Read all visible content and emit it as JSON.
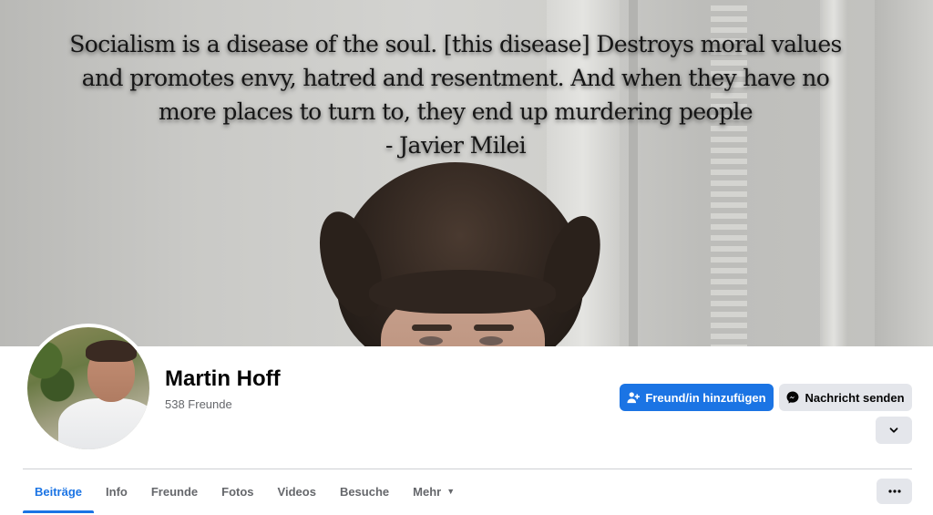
{
  "cover": {
    "quote_lines": [
      "Socialism is a disease of the soul. [this disease] Destroys moral values",
      "and promotes envy, hatred and resentment. And when they have no",
      "more places to turn to,  they end up murdering people",
      "- Javier Milei"
    ]
  },
  "profile": {
    "name": "Martin Hoff",
    "friends": "538 Freunde"
  },
  "actions": {
    "add_friend_label": "Freund/in hinzufügen",
    "message_label": "Nachricht senden"
  },
  "tabs": [
    {
      "label": "Beiträge",
      "active": true
    },
    {
      "label": "Info"
    },
    {
      "label": "Freunde"
    },
    {
      "label": "Fotos"
    },
    {
      "label": "Videos"
    },
    {
      "label": "Besuche"
    },
    {
      "label": "Mehr",
      "dropdown": true
    }
  ],
  "icons": {
    "add_friend": "person-add-icon",
    "message": "messenger-icon",
    "expand": "chevron-down-icon",
    "more": "ellipsis-icon",
    "tab_dropdown": "caret-down-icon"
  },
  "colors": {
    "accent": "#1b74e4",
    "button_secondary": "#e4e6eb",
    "text_secondary": "#65676b"
  }
}
